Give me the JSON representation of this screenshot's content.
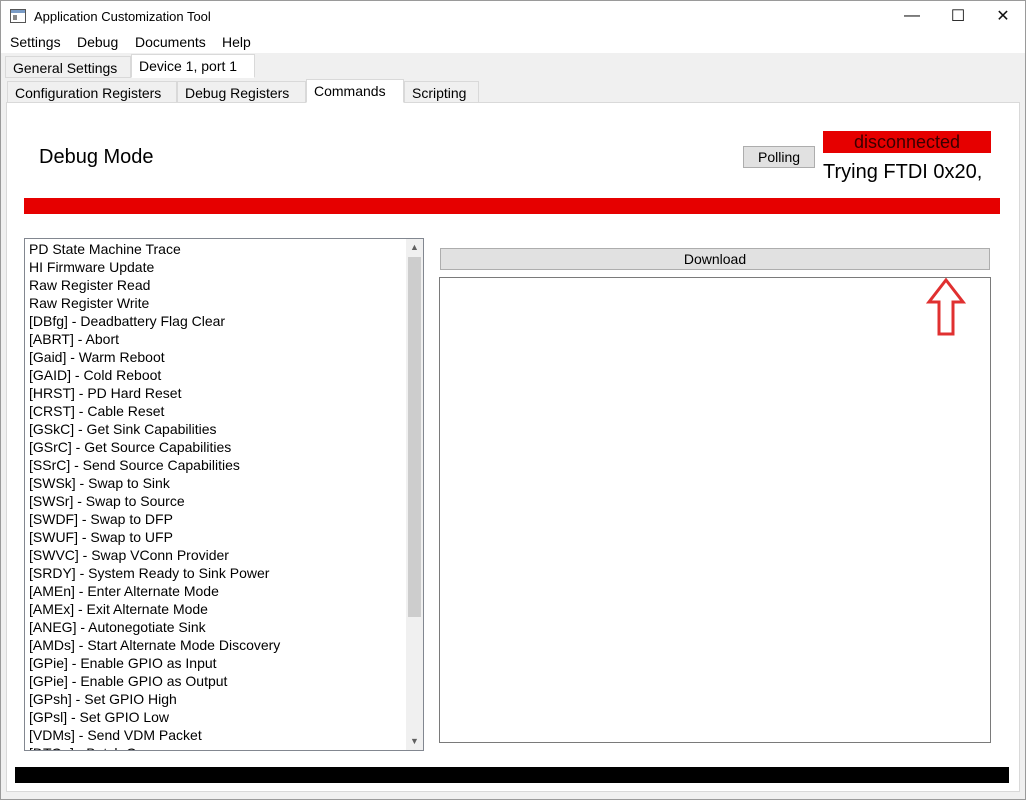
{
  "window": {
    "title": "Application Customization Tool",
    "min_glyph": "—",
    "max_glyph": "☐",
    "close_glyph": "✕"
  },
  "menu": [
    "Settings",
    "Debug",
    "Documents",
    "Help"
  ],
  "tabs_top": [
    "General Settings",
    "Device 1, port 1"
  ],
  "tabs_second": [
    "Configuration Registers",
    "Debug Registers",
    "Commands",
    "Scripting"
  ],
  "main": {
    "mode_title": "Debug Mode",
    "polling_label": "Polling",
    "status": "disconnected",
    "status_detail": "Trying FTDI 0x20,",
    "download_label": "Download"
  },
  "commands": [
    "PD State Machine Trace",
    "HI Firmware Update",
    "Raw Register Read",
    "Raw Register Write",
    "[DBfg] - Deadbattery Flag Clear",
    "[ABRT] - Abort",
    "[Gaid] - Warm Reboot",
    "[GAID] - Cold Reboot",
    "[HRST] - PD Hard Reset",
    "[CRST] - Cable Reset",
    "[GSkC] - Get Sink Capabilities",
    "[GSrC] - Get Source Capabilities",
    "[SSrC] - Send Source Capabilities",
    "[SWSk] - Swap to Sink",
    "[SWSr] - Swap to Source",
    "[SWDF] - Swap to DFP",
    "[SWUF] - Swap to UFP",
    "[SWVC] - Swap VConn Provider",
    "[SRDY] - System Ready to Sink Power",
    "[AMEn] - Enter Alternate Mode",
    "[AMEx] - Exit Alternate Mode",
    "[ANEG] - Autonegotiate Sink",
    "[AMDs] - Start Alternate Mode Discovery",
    "[GPie] - Enable GPIO as Input",
    "[GPie] - Enable GPIO as Output",
    "[GPsh] - Set GPIO High",
    "[GPsl] - Set GPIO Low",
    "[VDMs] - Send VDM Packet",
    "[DTOa] - Batch Op"
  ],
  "colors": {
    "status_red": "#e60000",
    "annotation_arrow": "#e03030"
  },
  "icons": {
    "app": "app-window-icon",
    "annotation": "arrow-up-outline-icon"
  }
}
